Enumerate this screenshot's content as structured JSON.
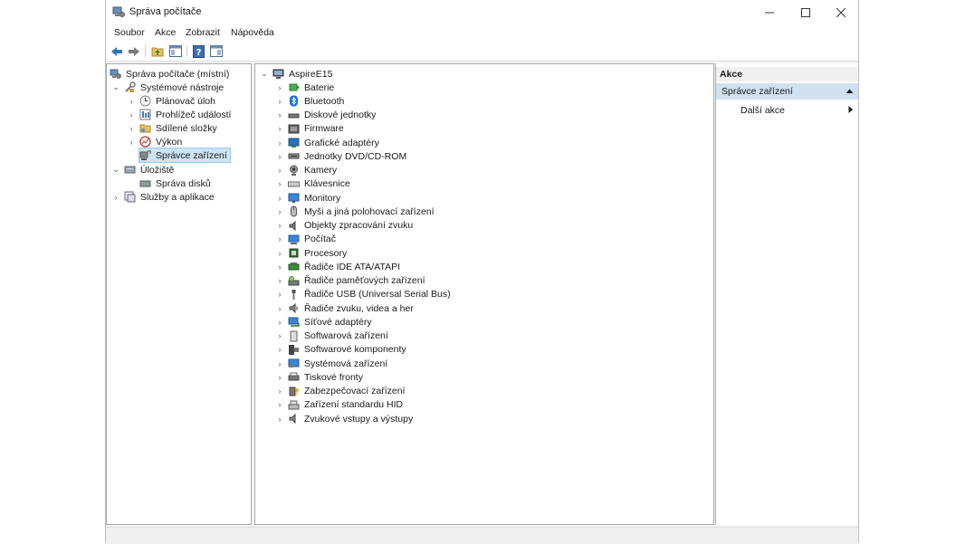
{
  "window": {
    "title": "Správa počítače"
  },
  "menu": [
    {
      "label": "Soubor"
    },
    {
      "label": "Akce"
    },
    {
      "label": "Zobrazit"
    },
    {
      "label": "Nápověda"
    }
  ],
  "left_tree": {
    "root": "Správa počítače (místní)",
    "system_tools": "Systémové nástroje",
    "task_scheduler": "Plánovač úloh",
    "event_viewer": "Prohlížeč událostí",
    "shared_folders": "Sdílené složky",
    "performance": "Výkon",
    "device_manager": "Správce zařízení",
    "storage": "Úložiště",
    "disk_management": "Správa disků",
    "services": "Služby a aplikace"
  },
  "device_tree": {
    "computer": "AspireE15",
    "categories": [
      {
        "label": "Baterie",
        "icon": "battery-icon"
      },
      {
        "label": "Bluetooth",
        "icon": "bluetooth-icon"
      },
      {
        "label": "Diskové jednotky",
        "icon": "disk-drive-icon"
      },
      {
        "label": "Firmware",
        "icon": "firmware-icon"
      },
      {
        "label": "Grafické adaptéry",
        "icon": "display-adapter-icon"
      },
      {
        "label": "Jednotky DVD/CD-ROM",
        "icon": "dvd-drive-icon"
      },
      {
        "label": "Kamery",
        "icon": "camera-icon"
      },
      {
        "label": "Klávesnice",
        "icon": "keyboard-icon"
      },
      {
        "label": "Monitory",
        "icon": "monitor-icon"
      },
      {
        "label": "Myši a jiná polohovací zařízení",
        "icon": "mouse-icon"
      },
      {
        "label": "Objekty zpracování zvuku",
        "icon": "audio-processing-icon"
      },
      {
        "label": "Počítač",
        "icon": "computer-icon"
      },
      {
        "label": "Procesory",
        "icon": "processor-icon"
      },
      {
        "label": "Řadiče IDE ATA/ATAPI",
        "icon": "ide-controller-icon"
      },
      {
        "label": "Řadiče paměťových zařízení",
        "icon": "storage-controller-icon"
      },
      {
        "label": "Řadiče USB (Universal Serial Bus)",
        "icon": "usb-icon"
      },
      {
        "label": "Řadiče zvuku, videa a her",
        "icon": "sound-controller-icon"
      },
      {
        "label": "Síťové adaptéry",
        "icon": "network-adapter-icon"
      },
      {
        "label": "Softwarová zařízení",
        "icon": "software-device-icon"
      },
      {
        "label": "Softwarové komponenty",
        "icon": "software-component-icon"
      },
      {
        "label": "Systémová zařízení",
        "icon": "system-device-icon"
      },
      {
        "label": "Tiskové fronty",
        "icon": "print-queue-icon"
      },
      {
        "label": "Zabezpečovací zařízení",
        "icon": "security-device-icon"
      },
      {
        "label": "Zařízení standardu HID",
        "icon": "hid-icon"
      },
      {
        "label": "Zvukové vstupy a výstupy",
        "icon": "audio-io-icon"
      }
    ]
  },
  "actions": {
    "header": "Akce",
    "group": "Správce zařízení",
    "more": "Další akce"
  }
}
